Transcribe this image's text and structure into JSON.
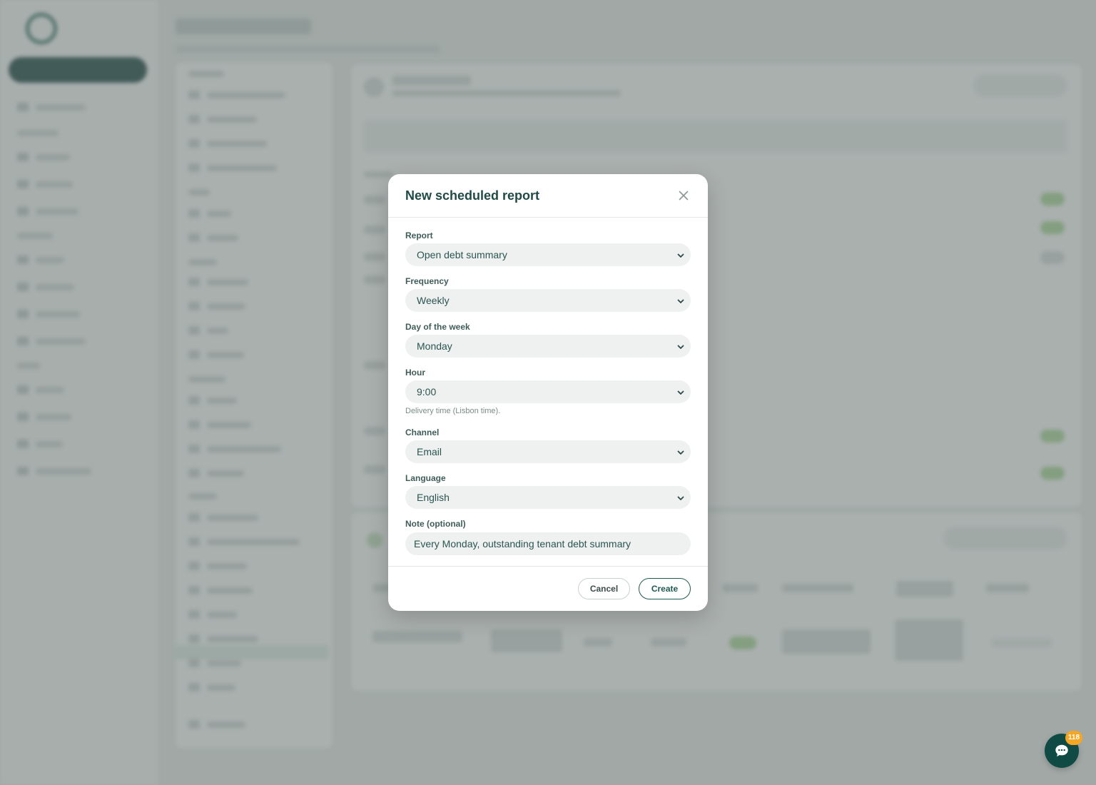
{
  "modal": {
    "title": "New scheduled report",
    "fields": {
      "report": {
        "label": "Report",
        "value": "Open debt summary"
      },
      "frequency": {
        "label": "Frequency",
        "value": "Weekly"
      },
      "day_of_week": {
        "label": "Day of the week",
        "value": "Monday"
      },
      "hour": {
        "label": "Hour",
        "value": "9:00",
        "hint": "Delivery time (Lisbon time)."
      },
      "channel": {
        "label": "Channel",
        "value": "Email"
      },
      "language": {
        "label": "Language",
        "value": "English"
      },
      "note": {
        "label": "Note (optional)",
        "value": "Every Monday, outstanding tenant debt summary"
      }
    },
    "buttons": {
      "cancel": "Cancel",
      "create": "Create"
    }
  },
  "chat": {
    "badge_count": "118"
  },
  "colors": {
    "brand_dark": "#0f4a44",
    "badge": "#f5a623",
    "accent_green": "#6ac46a"
  },
  "icons": {
    "close": "close-icon",
    "chevron": "chevron-down-icon",
    "chat": "chat-bubble-icon"
  }
}
